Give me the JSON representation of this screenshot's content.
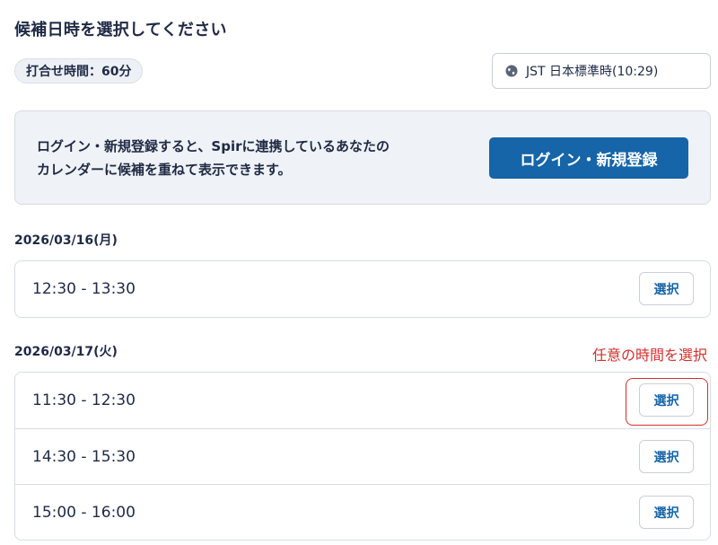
{
  "page": {
    "title": "候補日時を選択してください",
    "duration_label": "打合せ時間：60分",
    "timezone_label": "JST 日本標準時(10:29)"
  },
  "login_banner": {
    "line1": "ログイン・新規登録すると、Spirに連携しているあなたの",
    "line2": "カレンダーに候補を重ねて表示できます。",
    "button_label": "ログイン・新規登録"
  },
  "days": [
    {
      "date": "2026/03/16(月)",
      "slots": [
        {
          "time": "12:30 - 13:30",
          "button": "選択"
        }
      ]
    },
    {
      "date": "2026/03/17(火)",
      "slots": [
        {
          "time": "11:30 - 12:30",
          "button": "選択"
        },
        {
          "time": "14:30 - 15:30",
          "button": "選択"
        },
        {
          "time": "15:00 - 16:00",
          "button": "選択"
        }
      ]
    }
  ],
  "annotation": {
    "text": "任意の時間を選択",
    "color": "#d0302f"
  },
  "colors": {
    "primary": "#1565a8",
    "text": "#1f2a44",
    "banner_bg": "#eff2f6",
    "border": "#d7dce4"
  },
  "icons": {
    "timezone": "globe-icon"
  }
}
